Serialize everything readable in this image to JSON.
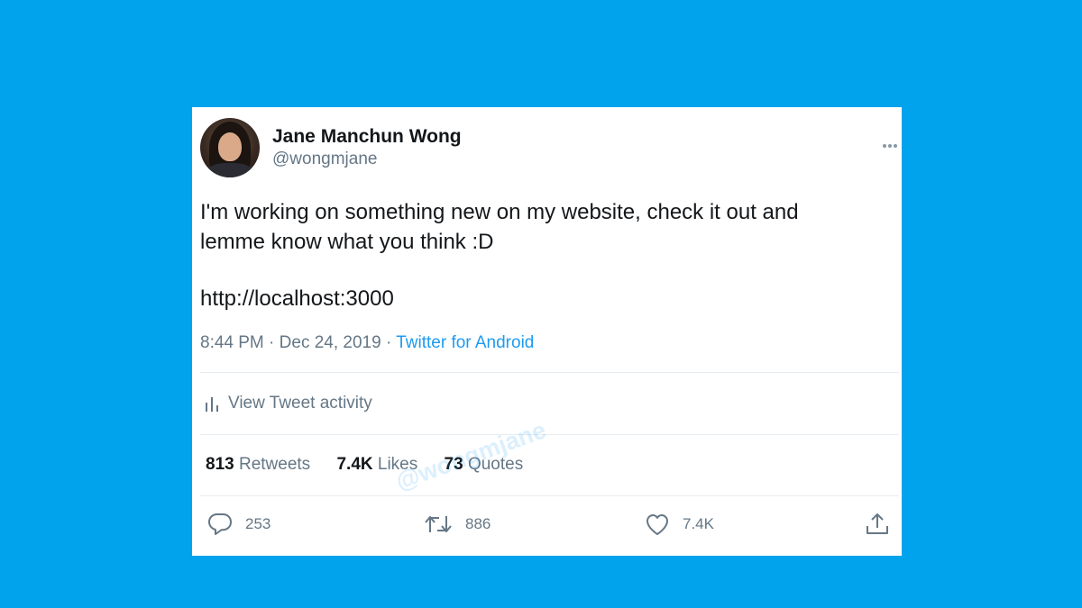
{
  "tweet": {
    "author_name": "Jane Manchun Wong",
    "author_handle": "@wongmjane",
    "text_line1": "I'm working on something new on my website, check it out and",
    "text_line2": "lemme know what you think :D",
    "url": "http://localhost:3000",
    "time": "8:44 PM",
    "date": "Dec 24, 2019",
    "separator": "·",
    "source": "Twitter for Android",
    "activity_label": "View Tweet activity",
    "retweets_count": "813",
    "retweets_label": "Retweets",
    "likes_count": "7.4K",
    "likes_label": "Likes",
    "quotes_count": "73",
    "quotes_label": "Quotes",
    "watermark": "@wongmjane"
  },
  "actions": {
    "reply_count": "253",
    "retweet_count": "886",
    "like_count": "7.4K"
  },
  "icons": {
    "more": "more-icon",
    "activity": "bar-chart-icon",
    "reply": "reply-icon",
    "retweet": "retweet-icon",
    "like": "heart-icon",
    "share": "share-icon"
  },
  "colors": {
    "background": "#00a3ec",
    "link": "#1d9bf0",
    "muted": "#657786",
    "text": "#14171a"
  }
}
